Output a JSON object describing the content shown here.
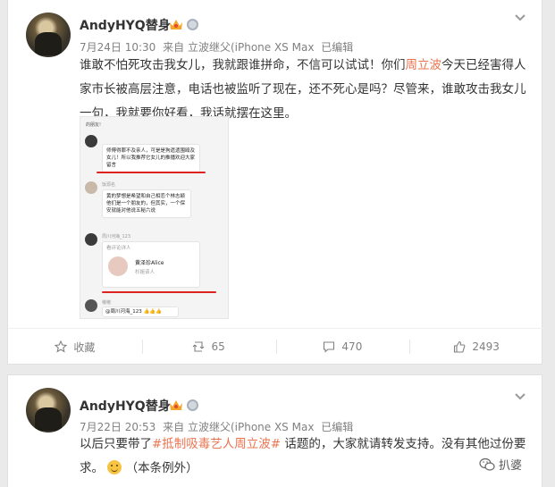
{
  "posts": [
    {
      "username": "AndyHYQ替身",
      "meta": {
        "date": "7月24日 10:30",
        "source": "来自 立波继父(iPhone XS Max",
        "edited": "已编辑"
      },
      "text_before": "谁敢不怕死攻击我女儿，我就跟谁拼命，不信可以试试！你们",
      "text_highlight": "周立波",
      "text_after": "今天已经害得人家市长被高层注意，电话也被监听了现在，还不死心是吗？尽管来，谁敢攻击我女儿一句，我就要你好看，我话就摆在这里。",
      "image": {
        "top_label": "的朋友!",
        "msg1": "师傅得罪不及亲人，可是是狗遗遗围殴及女儿！所以我推荐它女儿的推播欢迎大家留言",
        "user2": "饭源名",
        "msg2": "黄的梦想是希望和自己相恋个林志颖他们是一个朋友的，但其实，一个保安就能对他说五秘六说",
        "user3": "周川河海_123",
        "card_caption": "看评论详人",
        "card_name": "黄泽珍Alice",
        "card_sub": "杉姐该人",
        "user4": "嗷嗷",
        "msg4": "@周川河海_123 👍👍👍"
      },
      "actions": {
        "favorite": "收藏",
        "repost": "65",
        "comment": "470",
        "like": "2493"
      }
    },
    {
      "username": "AndyHYQ替身",
      "meta": {
        "date": "7月22日 20:53",
        "source": "来自 立波继父(iPhone XS Max",
        "edited": "已编辑"
      },
      "text_before": "以后只要带了",
      "hashtag": "#抵制吸毒艺人周立波#",
      "text_after": " 话题的，大家就请转发支持。没有其他过份要求。",
      "text_tail": "（本条例外）"
    }
  ],
  "watermark": "扒婆",
  "colors": {
    "accent": "#eb7350",
    "meta": "#808080",
    "background": "#eaeaea"
  },
  "icons": [
    "vip-crown-icon",
    "medal-icon",
    "chevron-down-icon",
    "star-icon",
    "repost-icon",
    "comment-icon",
    "thumbs-up-icon",
    "smile-emoji-icon",
    "wechat-icon"
  ]
}
